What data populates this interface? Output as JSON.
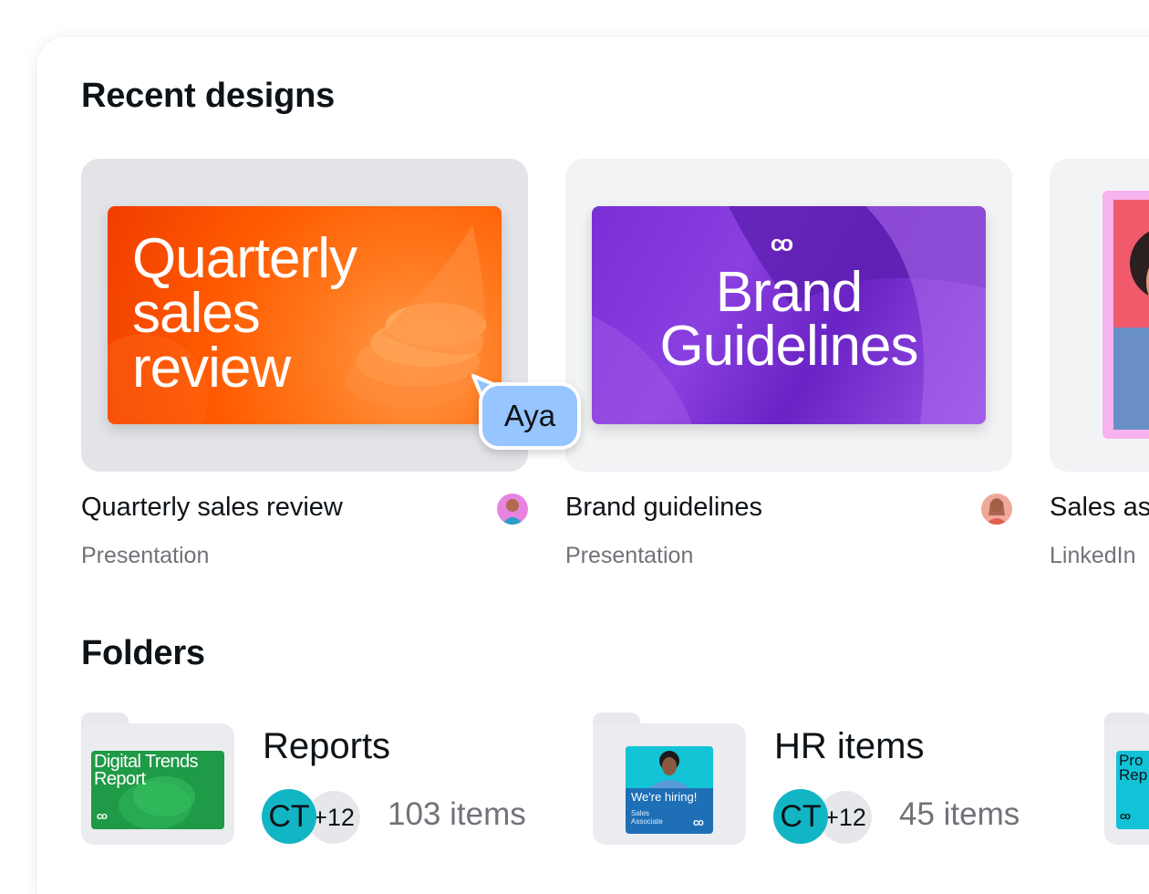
{
  "recent": {
    "title": "Recent designs",
    "designs": [
      {
        "thumb_title": "Quarterly sales review",
        "name": "Quarterly sales review",
        "type": "Presentation"
      },
      {
        "thumb_title": "Brand Guidelines",
        "name": "Brand guidelines",
        "type": "Presentation"
      },
      {
        "name": "Sales as",
        "type": "LinkedIn"
      }
    ],
    "cursor_user": "Aya"
  },
  "folders": {
    "title": "Folders",
    "items": [
      {
        "name": "Reports",
        "thumb_title": "Digital Trends Report",
        "owner_initials": "CT",
        "extra_members": "+12",
        "count": "103 items"
      },
      {
        "name": "HR items",
        "thumb_title": "We're hiring!",
        "thumb_subtitle": "Sales Associate",
        "owner_initials": "CT",
        "extra_members": "+12",
        "count": "45 items"
      },
      {
        "thumb_title": "Pro Rep"
      }
    ]
  },
  "colors": {
    "cursor": "#96c5ff",
    "badge": "#12b5c4",
    "orange_thumb": "#ff5a00",
    "purple_thumb": "#7a2fd6"
  }
}
